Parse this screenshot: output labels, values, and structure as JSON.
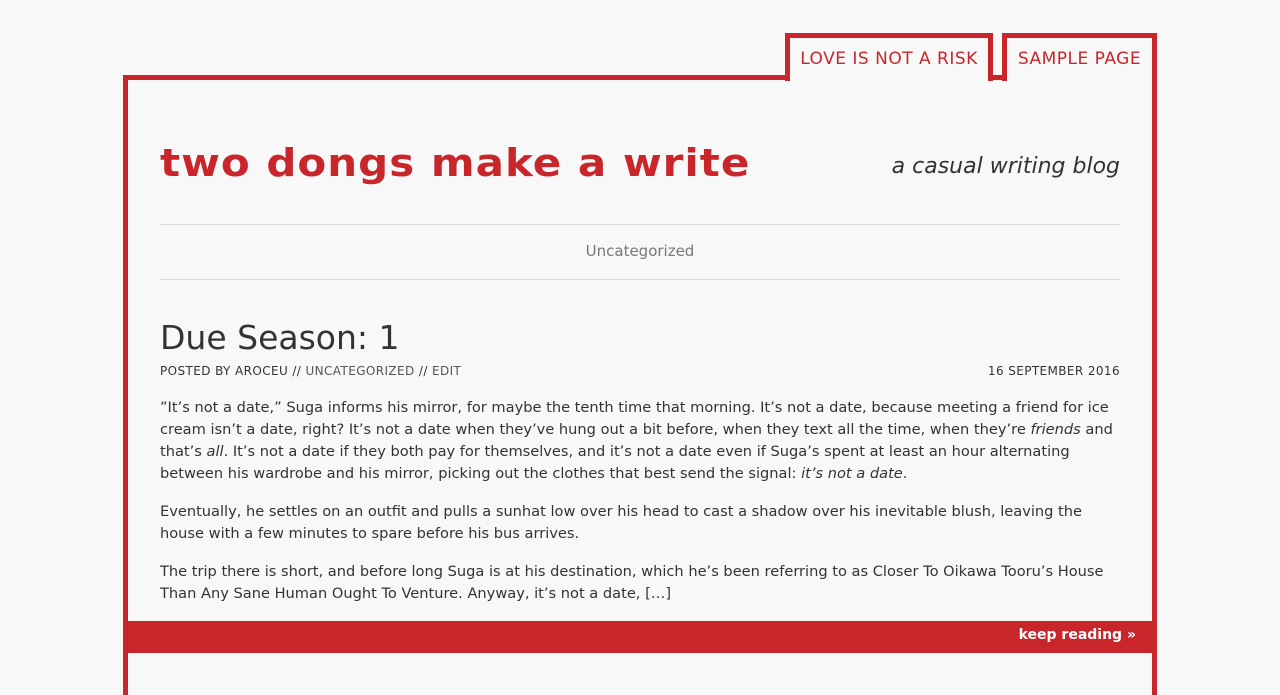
{
  "nav": {
    "tabs": [
      {
        "label": "LOVE IS NOT A RISK"
      },
      {
        "label": "SAMPLE PAGE"
      }
    ]
  },
  "header": {
    "site_title": "two dongs make a write",
    "tagline": "a casual writing blog"
  },
  "archive": {
    "category_heading": "Uncategorized"
  },
  "post": {
    "title": "Due Season: 1",
    "meta": {
      "posted_by_prefix": "POSTED BY ",
      "author": "AROCEU",
      "sep1": " // ",
      "category": "UNCATEGORIZED",
      "sep2": " // ",
      "edit": "EDIT",
      "date": "16 SEPTEMBER 2016"
    },
    "paragraphs": {
      "p1_a": "”It’s not a date,” Suga informs his mirror, for maybe the tenth time that morning. It’s not a date, because meeting a friend for ice cream isn’t a date, right? It’s not a date when they’ve hung out a bit before, when they text all the time, when they’re ",
      "p1_em1": "friends",
      "p1_b": " and that’s ",
      "p1_em2": "all",
      "p1_c": ". It’s not a date if they both pay for themselves, and it’s not a date even if Suga’s spent at least an hour alternating between his wardrobe and his mirror, picking out the clothes that best send the signal: ",
      "p1_em3": "it’s not a date",
      "p1_d": ".",
      "p2": "Eventually, he settles on an outfit and pulls a sunhat low over his head to cast a shadow over his inevitable blush, leaving the house with a few minutes to spare before his bus arrives.",
      "p3": "The trip there is short, and before long Suga is at his destination, which he’s been referring to as Closer To Oikawa Tooru’s House Than Any Sane Human Ought To Venture. Anyway, it’s not a date, […]"
    },
    "read_more": "keep reading »"
  },
  "colors": {
    "accent": "#c8262b",
    "background": "#f8f8f8",
    "text": "#333333"
  }
}
